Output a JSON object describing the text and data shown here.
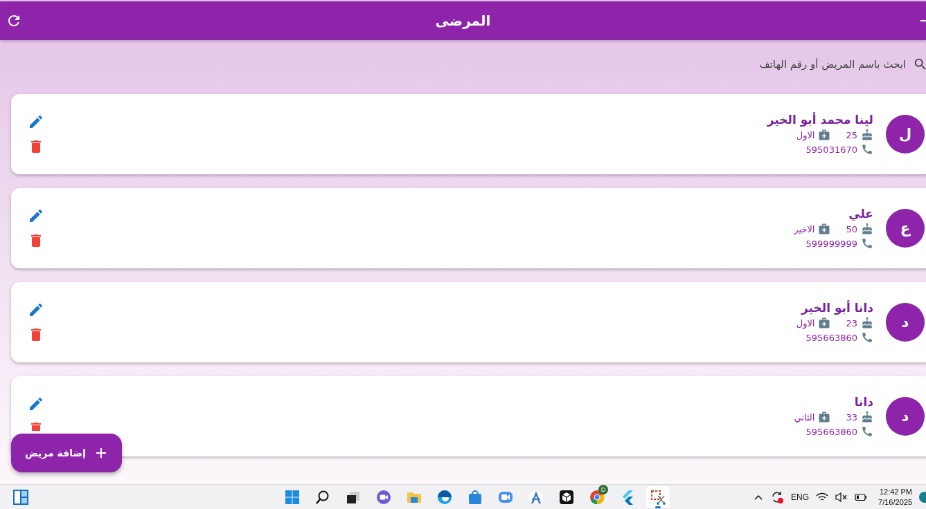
{
  "app_bar": {
    "title": "المرضى"
  },
  "search": {
    "placeholder": "ابحث باسم المريض أو رقم الهاتف"
  },
  "patients": [
    {
      "initial": "ل",
      "name": "لينا محمد أبو الخير",
      "age": "25",
      "category": "الاول",
      "phone": "595031670"
    },
    {
      "initial": "ع",
      "name": "علي",
      "age": "50",
      "category": "الاخير",
      "phone": "599999999"
    },
    {
      "initial": "د",
      "name": "دانا  أبو الخير",
      "age": "23",
      "category": "الاول",
      "phone": "595663860"
    },
    {
      "initial": "د",
      "name": "دانا",
      "age": "33",
      "category": "الثاني",
      "phone": "595663860"
    }
  ],
  "add_button": {
    "label": "إضافة مريض"
  },
  "taskbar": {
    "apps": [
      {
        "kind": "start"
      },
      {
        "kind": "search"
      },
      {
        "kind": "taskview"
      },
      {
        "kind": "chat"
      },
      {
        "kind": "folder"
      },
      {
        "kind": "edge"
      },
      {
        "kind": "store"
      },
      {
        "kind": "video"
      },
      {
        "kind": "studio"
      },
      {
        "kind": "cube"
      },
      {
        "kind": "chrome",
        "badge": "D"
      },
      {
        "kind": "flutter"
      },
      {
        "kind": "snip",
        "selected": true
      }
    ],
    "language": "ENG",
    "time": "12:42 PM",
    "date": "7/16/2025"
  }
}
